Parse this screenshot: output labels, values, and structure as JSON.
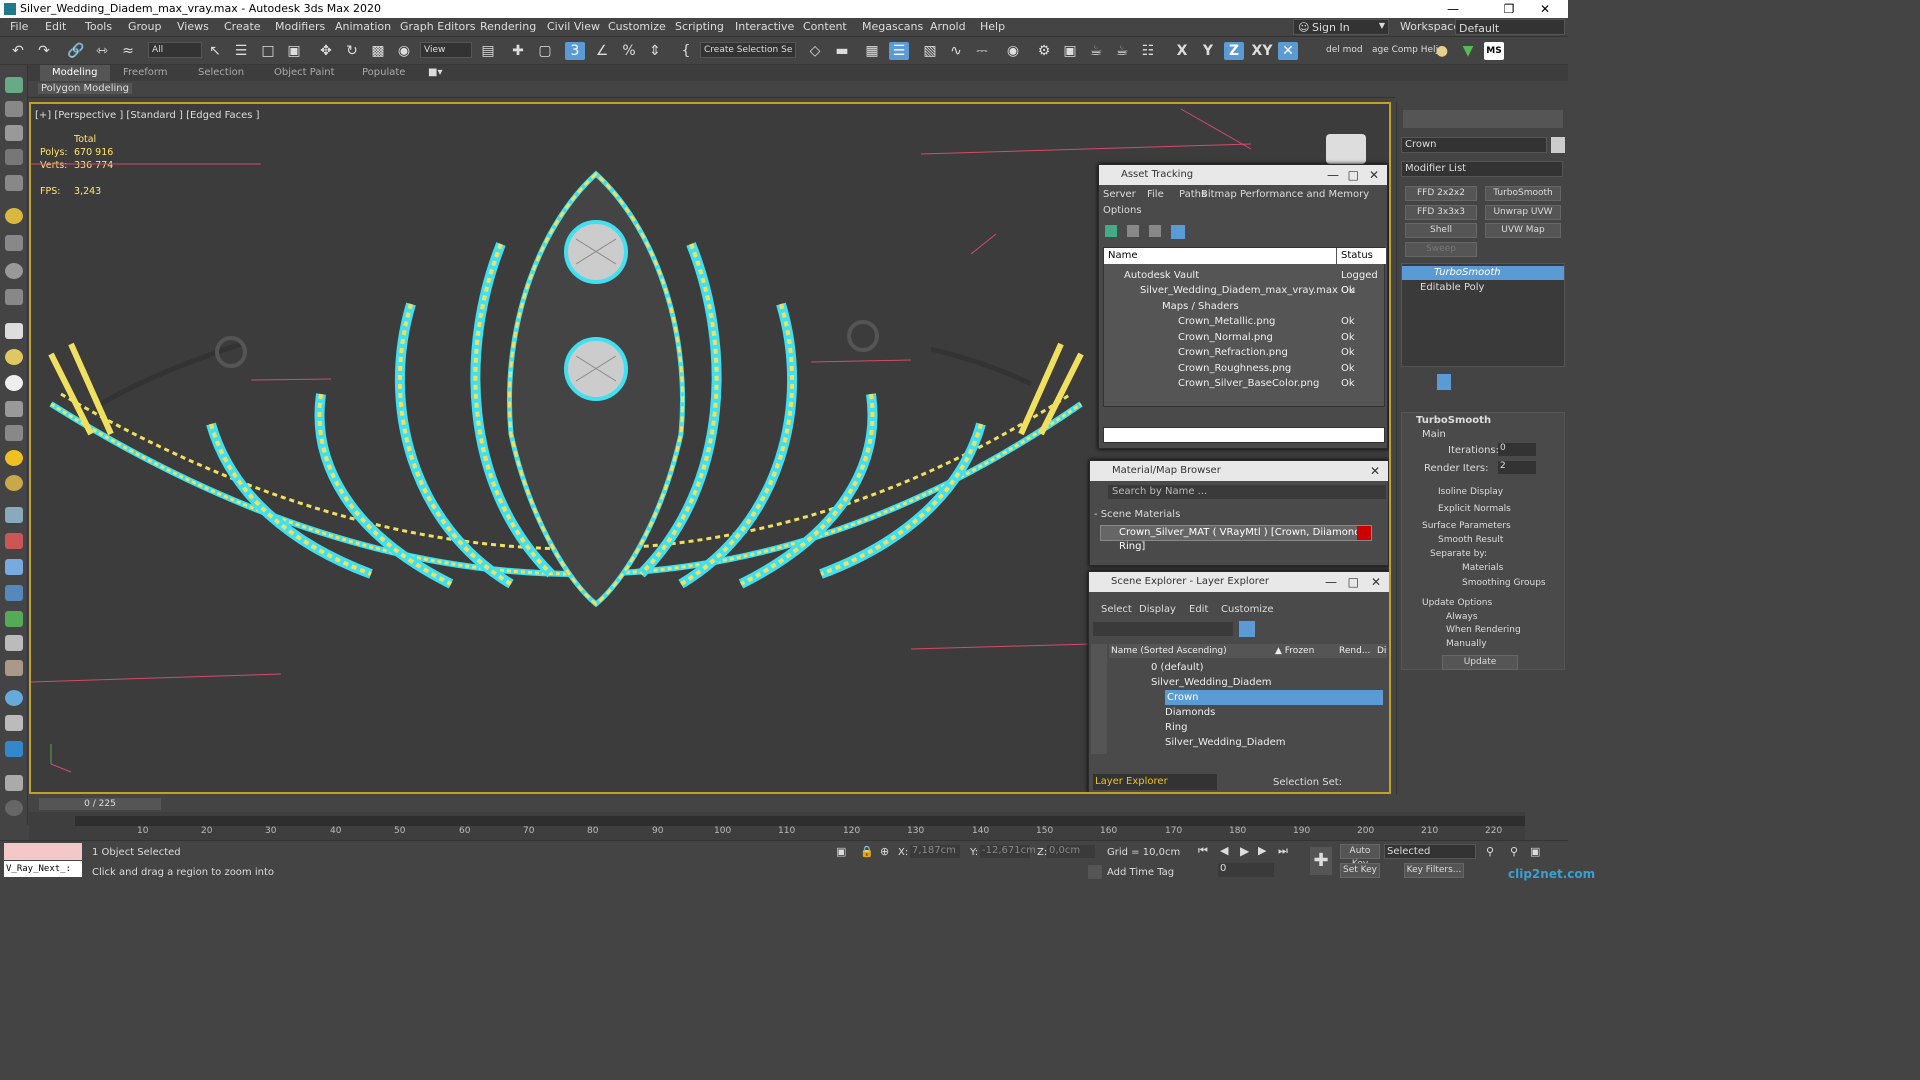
{
  "window": {
    "title": "Silver_Wedding_Diadem_max_vray.max - Autodesk 3ds Max 2020"
  },
  "menu": [
    "File",
    "Edit",
    "Tools",
    "Group",
    "Views",
    "Create",
    "Modifiers",
    "Animation",
    "Graph Editors",
    "Rendering",
    "Civil View",
    "Customize",
    "Scripting",
    "Interactive",
    "Content",
    "Megascans",
    "Arnold",
    "Help"
  ],
  "signin": "Sign In",
  "workspaces_label": "Workspaces:",
  "workspaces_value": "Default",
  "toolbar": {
    "filter_value": "All",
    "view_value": "View",
    "selection_set_placeholder": "Create Selection Se",
    "axis": [
      "X",
      "Y",
      "Z",
      "XY"
    ],
    "delmod": "del mod",
    "compheli": "age Comp Helj",
    "ms": "MS"
  },
  "ribbon": {
    "tabs": [
      "Modeling",
      "Freeform",
      "Selection",
      "Object Paint",
      "Populate"
    ],
    "subtab": "Polygon Modeling"
  },
  "viewport": {
    "label": "[+] [Perspective ] [Standard ] [Edged Faces ]",
    "total_label": "Total",
    "polys_label": "Polys:",
    "polys_value": "670 916",
    "verts_label": "Verts:",
    "verts_value": "336 774",
    "fps_label": "FPS:",
    "fps_value": "3,243"
  },
  "asset_tracking": {
    "title": "Asset Tracking",
    "menu": [
      "Server",
      "File",
      "Paths",
      "Bitmap Performance and Memory",
      "Options"
    ],
    "col_name": "Name",
    "col_status": "Status",
    "rows": [
      {
        "name": "Autodesk Vault",
        "status": "Logged Ou"
      },
      {
        "name": "Silver_Wedding_Diadem_max_vray.max",
        "status": "Ok"
      },
      {
        "name": "Maps / Shaders",
        "status": ""
      },
      {
        "name": "Crown_Metallic.png",
        "status": "Ok"
      },
      {
        "name": "Crown_Normal.png",
        "status": "Ok"
      },
      {
        "name": "Crown_Refraction.png",
        "status": "Ok"
      },
      {
        "name": "Crown_Roughness.png",
        "status": "Ok"
      },
      {
        "name": "Crown_Silver_BaseColor.png",
        "status": "Ok"
      }
    ]
  },
  "material_browser": {
    "title": "Material/Map Browser",
    "search_placeholder": "Search by Name ...",
    "section": "- Scene Materials",
    "material": "Crown_Silver_MAT ( VRayMtl ) [Crown, Diiamonds, Ring]"
  },
  "scene_explorer": {
    "title": "Scene Explorer - Layer Explorer",
    "menu": [
      "Select",
      "Display",
      "Edit",
      "Customize"
    ],
    "col_name": "Name (Sorted Ascending)",
    "col_frozen": "▲ Frozen",
    "col_render": "Rend...",
    "col_d": "Di",
    "rows": [
      "0 (default)",
      "Silver_Wedding_Diadem",
      "Crown",
      "Diamonds",
      "Ring",
      "Silver_Wedding_Diadem"
    ],
    "footer_left": "Layer Explorer",
    "footer_right": "Selection Set:"
  },
  "command_panel": {
    "object_name": "Crown",
    "modifier_list": "Modifier List",
    "buttons": [
      "FFD 2x2x2",
      "TurboSmooth",
      "FFD 3x3x3",
      "Unwrap UVW",
      "Shell",
      "UVW Map",
      "Sweep"
    ],
    "stack": [
      "TurboSmooth",
      "Editable Poly"
    ],
    "rollout_title": "TurboSmooth",
    "main_label": "Main",
    "iterations_label": "Iterations:",
    "iterations_value": "0",
    "render_iters_label": "Render Iters:",
    "render_iters_value": "2",
    "isoline": "Isoline Display",
    "explicit_normals": "Explicit Normals",
    "surface_params": "Surface Parameters",
    "smooth_result": "Smooth Result",
    "separate_by": "Separate by:",
    "materials": "Materials",
    "smoothing_groups": "Smoothing Groups",
    "update_options": "Update Options",
    "always": "Always",
    "when_rendering": "When Rendering",
    "manually": "Manually",
    "update_btn": "Update"
  },
  "timeline": {
    "counter": "0 / 225",
    "ticks": [
      "10",
      "20",
      "30",
      "40",
      "50",
      "60",
      "70",
      "80",
      "90",
      "100",
      "110",
      "120",
      "130",
      "140",
      "150",
      "160",
      "170",
      "180",
      "190",
      "200",
      "210",
      "220"
    ]
  },
  "status": {
    "script_listener": "V_Ray_Next_:",
    "selected": "1 Object Selected",
    "prompt": "Click and drag a region to zoom into",
    "x_label": "X:",
    "x_value": "7,187cm",
    "y_label": "Y:",
    "y_value": "-12,671cm",
    "z_label": "Z:",
    "z_value": "0,0cm",
    "grid": "Grid = 10,0cm",
    "add_time_tag": "Add Time Tag",
    "auto_key": "Auto Key",
    "selected_dd": "Selected",
    "set_key": "Set Key",
    "key_filters": "Key Filters...",
    "frame_value": "0",
    "watermark": "clip2net.com"
  },
  "colors": {
    "accent": "#5b9bd5",
    "viewport_border": "#c8a020",
    "wire_yellow": "#f0e060",
    "wire_cyan": "#40e0f0"
  }
}
